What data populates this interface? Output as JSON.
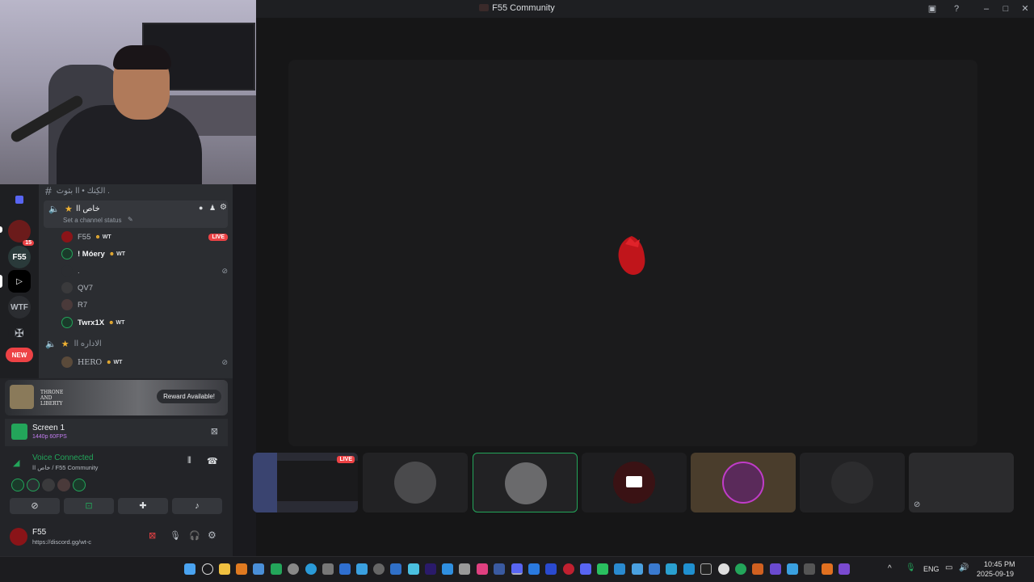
{
  "window": {
    "title": "F55 Community"
  },
  "channels": {
    "text_channel": "الكِنك • اا بثوث .",
    "voice_channel_1": {
      "name": "خاص اا",
      "status_placeholder": "Set a channel status"
    },
    "voice_channel_2": {
      "name": "الاداره اا"
    },
    "users": [
      {
        "name": "F55",
        "tag": "WT",
        "live": "LIVE"
      },
      {
        "name": "! Móery",
        "tag": "WT"
      },
      {
        "name": "."
      },
      {
        "name": "QV7"
      },
      {
        "name": "R7"
      },
      {
        "name": "Twrx1X",
        "tag": "WT"
      }
    ],
    "users_2": [
      {
        "name": "HERO",
        "tag": "WT"
      }
    ]
  },
  "rail": {
    "badge_count": "15",
    "wtf_label": "WTF",
    "new_label": "NEW"
  },
  "promo": {
    "game": "THRONE AND LIBERTY",
    "button": "Reward Available!"
  },
  "screen_share": {
    "title": "Screen 1",
    "quality": "1440p 60FPS"
  },
  "voice": {
    "status": "Voice Connected",
    "location": "خاص اا / F55 Community"
  },
  "user": {
    "name": "F55",
    "status": "https://discord.gg/wt-c"
  },
  "stage": {
    "live_badge": "LIVE"
  },
  "taskbar": {
    "lang": "ENG",
    "time": "10:45 PM",
    "date": "2025-09-19"
  },
  "colors": {
    "accent_green": "#23a55a",
    "live_red": "#ed4245",
    "blurple": "#5865f2"
  }
}
